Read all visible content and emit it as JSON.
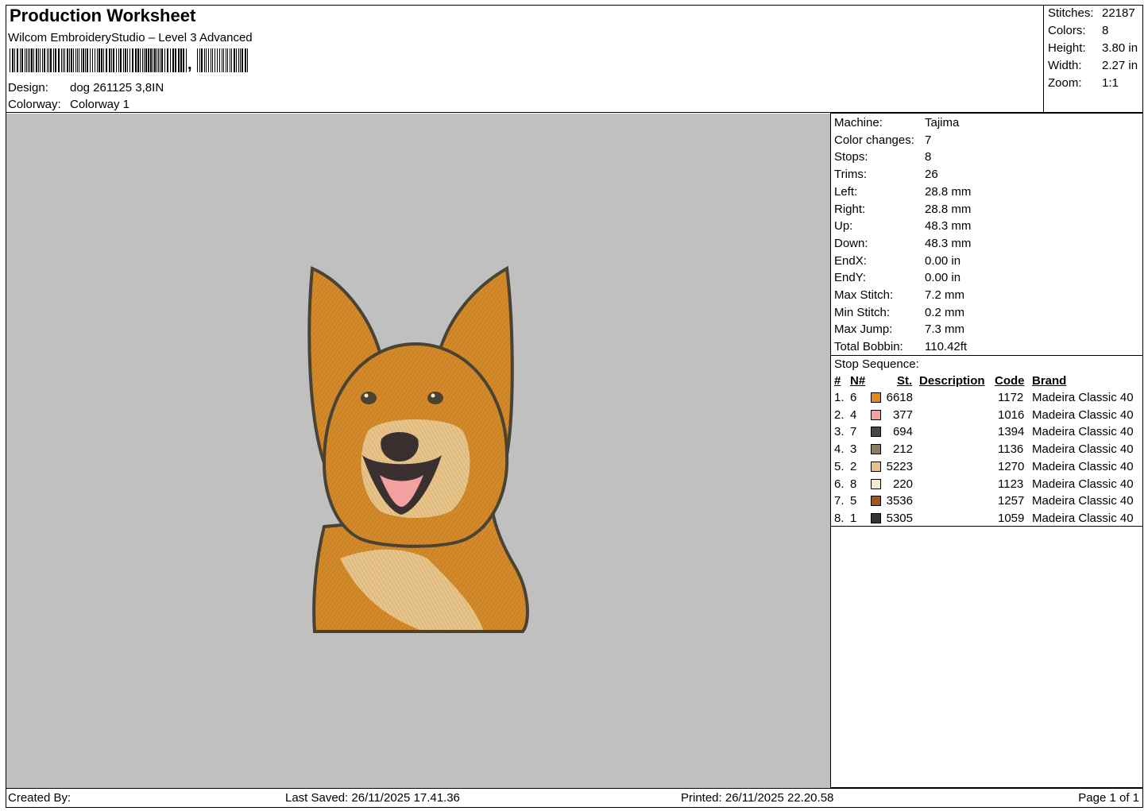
{
  "header": {
    "title": "Production Worksheet",
    "software": "Wilcom EmbroideryStudio – Level 3 Advanced",
    "barcode_suffix": ",",
    "design_label": "Design:",
    "design_value": "dog 261125 3,8IN",
    "colorway_label": "Colorway:",
    "colorway_value": "Colorway 1"
  },
  "summary": [
    {
      "label": "Stitches:",
      "value": "22187"
    },
    {
      "label": "Colors:",
      "value": "8"
    },
    {
      "label": "Height:",
      "value": "3.80 in"
    },
    {
      "label": "Width:",
      "value": "2.27 in"
    },
    {
      "label": "Zoom:",
      "value": "1:1"
    }
  ],
  "details": [
    {
      "label": "Machine:",
      "value": "Tajima"
    },
    {
      "label": "Color changes:",
      "value": "7"
    },
    {
      "label": "Stops:",
      "value": "8"
    },
    {
      "label": "Trims:",
      "value": "26"
    },
    {
      "label": "Left:",
      "value": "28.8 mm"
    },
    {
      "label": "Right:",
      "value": "28.8 mm"
    },
    {
      "label": "Up:",
      "value": "48.3 mm"
    },
    {
      "label": "Down:",
      "value": "48.3 mm"
    },
    {
      "label": "EndX:",
      "value": "0.00 in"
    },
    {
      "label": "EndY:",
      "value": "0.00 in"
    },
    {
      "label": "Max Stitch:",
      "value": "7.2 mm"
    },
    {
      "label": "Min Stitch:",
      "value": "0.2 mm"
    },
    {
      "label": "Max Jump:",
      "value": "7.3 mm"
    },
    {
      "label": "Total Bobbin:",
      "value": "110.42ft"
    }
  ],
  "stop_sequence": {
    "title": "Stop Sequence:",
    "columns": {
      "idx": "#",
      "n": "N#",
      "st": "St.",
      "desc": "Description",
      "code": "Code",
      "brand": "Brand"
    },
    "rows": [
      {
        "idx": "1.",
        "n": "6",
        "color": "#e08a1e",
        "st": "6618",
        "code": "1172",
        "brand": "Madeira Classic 40"
      },
      {
        "idx": "2.",
        "n": "4",
        "color": "#f2a0a0",
        "st": "377",
        "code": "1016",
        "brand": "Madeira Classic 40"
      },
      {
        "idx": "3.",
        "n": "7",
        "color": "#4a4a3c",
        "st": "694",
        "code": "1394",
        "brand": "Madeira Classic 40"
      },
      {
        "idx": "4.",
        "n": "3",
        "color": "#8c7a64",
        "st": "212",
        "code": "1136",
        "brand": "Madeira Classic 40"
      },
      {
        "idx": "5.",
        "n": "2",
        "color": "#e8c08a",
        "st": "5223",
        "code": "1270",
        "brand": "Madeira Classic 40"
      },
      {
        "idx": "6.",
        "n": "8",
        "color": "#f3ead0",
        "st": "220",
        "code": "1123",
        "brand": "Madeira Classic 40"
      },
      {
        "idx": "7.",
        "n": "5",
        "color": "#a8521e",
        "st": "3536",
        "code": "1257",
        "brand": "Madeira Classic 40"
      },
      {
        "idx": "8.",
        "n": "1",
        "color": "#3a3030",
        "st": "5305",
        "code": "1059",
        "brand": "Madeira Classic 40"
      }
    ]
  },
  "footer": {
    "created_by": "Created By:",
    "last_saved": "Last Saved: 26/11/2025 17.41.36",
    "printed": "Printed: 26/11/2025 22.20.58",
    "page": "Page 1 of 1"
  },
  "colors": {
    "canvas_bg": "#c0c0c0",
    "dog_fur": "#d38a2a",
    "dog_light": "#e6c48a",
    "outline": "#4a4232"
  }
}
